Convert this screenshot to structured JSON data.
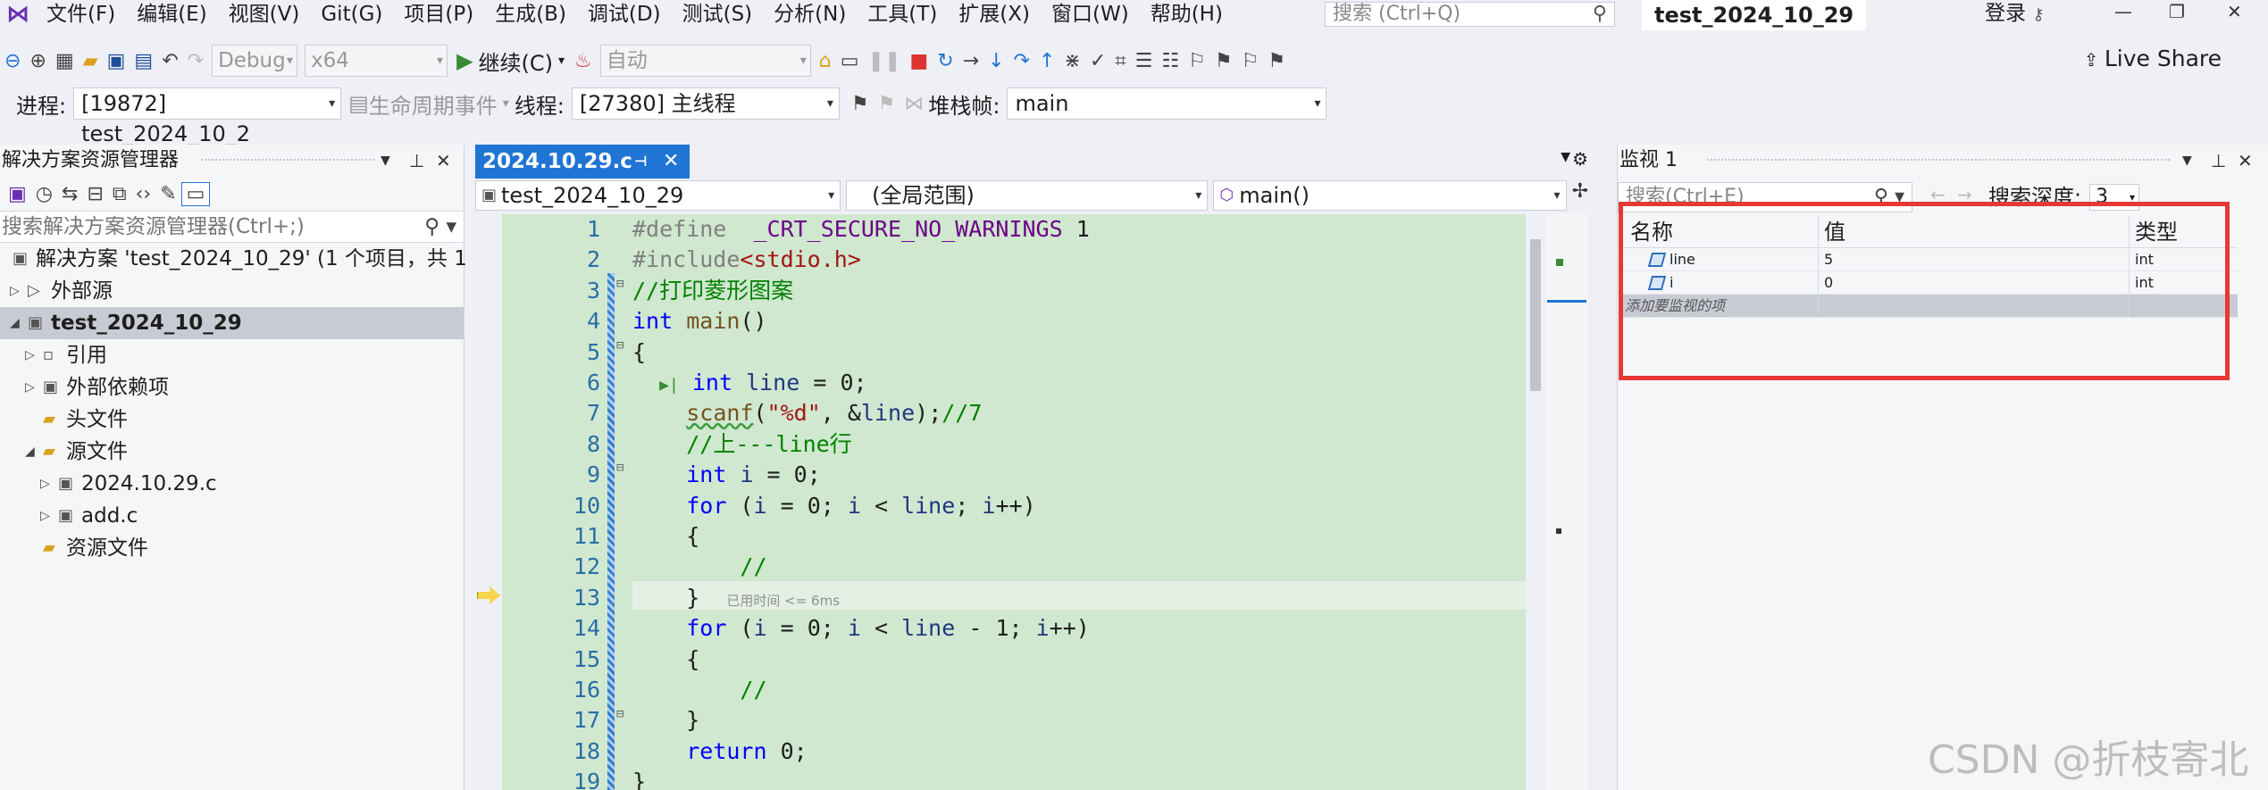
{
  "menubar": {
    "items": [
      "文件(F)",
      "编辑(E)",
      "视图(V)",
      "Git(G)",
      "项目(P)",
      "生成(B)",
      "调试(D)",
      "测试(S)",
      "分析(N)",
      "工具(T)",
      "扩展(X)",
      "窗口(W)",
      "帮助(H)"
    ],
    "search_placeholder": "搜索 (Ctrl+Q)",
    "solution_name": "test_2024_10_29",
    "login": "登录"
  },
  "toolbar1": {
    "config": "Debug",
    "platform": "x64",
    "continue_label": "继续(C)",
    "auto_label": "自动",
    "live_share": "Live Share"
  },
  "toolbar2": {
    "process_label": "进程:",
    "process_value": "[19872] test_2024_10_2",
    "lifecycle_label": "生命周期事件",
    "thread_label": "线程:",
    "thread_value": "[27380] 主线程",
    "stack_label": "堆栈帧:",
    "stack_value": "main"
  },
  "solution_explorer": {
    "title": "解决方案资源管理器",
    "search_placeholder": "搜索解决方案资源管理器(Ctrl+;)",
    "tree": [
      {
        "label": "解决方案 'test_2024_10_29' (1 个项目，共 1",
        "indent": 0
      },
      {
        "label": "外部源",
        "indent": 1
      },
      {
        "label": "test_2024_10_29",
        "indent": 1,
        "selected": true
      },
      {
        "label": "引用",
        "indent": 2
      },
      {
        "label": "外部依赖项",
        "indent": 2
      },
      {
        "label": "头文件",
        "indent": 2
      },
      {
        "label": "源文件",
        "indent": 2
      },
      {
        "label": "2024.10.29.c",
        "indent": 3
      },
      {
        "label": "add.c",
        "indent": 3
      },
      {
        "label": "资源文件",
        "indent": 2
      }
    ]
  },
  "editor": {
    "tab_label": "2024.10.29.c",
    "nav_project": "test_2024_10_29",
    "nav_scope": "(全局范围)",
    "nav_function": "main()",
    "elapsed_hint": "已用时间 <= 6ms",
    "current_line": 13,
    "line_numbers": [
      "1",
      "2",
      "3",
      "4",
      "5",
      "6",
      "7",
      "8",
      "9",
      "10",
      "11",
      "12",
      "13",
      "14",
      "15",
      "16",
      "17",
      "18",
      "19"
    ]
  },
  "watch": {
    "title": "监视 1",
    "search_placeholder": "搜索(Ctrl+E)",
    "depth_label": "搜索深度:",
    "depth_value": "3",
    "headers": {
      "name": "名称",
      "value": "值",
      "type": "类型"
    },
    "rows": [
      {
        "name": "line",
        "value": "5",
        "type": "int"
      },
      {
        "name": "i",
        "value": "0",
        "type": "int"
      }
    ],
    "add_label": "添加要监视的项"
  },
  "watermark": "CSDN @折枝寄北",
  "colors": {
    "accent": "#1f74d4",
    "highlight": "#e53935",
    "code_bg": "#cfe8cf"
  }
}
